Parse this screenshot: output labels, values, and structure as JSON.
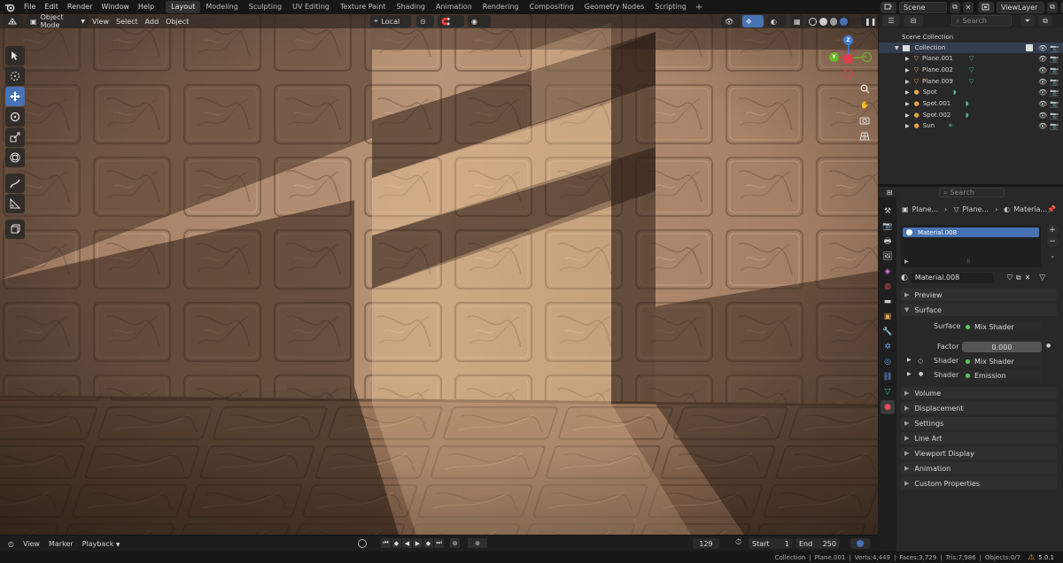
{
  "menubar": {
    "items": [
      "File",
      "Edit",
      "Render",
      "Window",
      "Help"
    ],
    "workspaces": [
      "Layout",
      "Modeling",
      "Sculpting",
      "UV Editing",
      "Texture Paint",
      "Shading",
      "Animation",
      "Rendering",
      "Compositing",
      "Geometry Nodes",
      "Scripting"
    ],
    "active_workspace": "Layout",
    "add_tab": "+",
    "scene_name": "Scene",
    "viewlayer_name": "ViewLayer"
  },
  "viewport": {
    "mode": "Object Mode",
    "menus": [
      "View",
      "Select",
      "Add",
      "Object"
    ],
    "orientation": "Local",
    "gizmo_axes": [
      "X",
      "Y",
      "Z"
    ]
  },
  "timeline": {
    "menus": [
      "View",
      "Marker",
      "Playback"
    ],
    "current_frame": "129",
    "start_label": "Start",
    "start_value": "1",
    "end_label": "End",
    "end_value": "250"
  },
  "status": {
    "collection": "Collection",
    "object": "Plane.001",
    "verts": "Verts:4,449",
    "faces": "Faces:3,729",
    "tris": "Tris:7,986",
    "objects": "Objects:0/7",
    "version": "5.0.1"
  },
  "outliner": {
    "search_placeholder": "Search",
    "root": "Scene Collection",
    "collection": "Collection",
    "items": [
      {
        "name": "Plane.001",
        "type": "mesh"
      },
      {
        "name": "Plane.002",
        "type": "mesh"
      },
      {
        "name": "Plane.009",
        "type": "mesh"
      },
      {
        "name": "Spot",
        "type": "light"
      },
      {
        "name": "Spot.001",
        "type": "light"
      },
      {
        "name": "Spot.002",
        "type": "light"
      },
      {
        "name": "Sun",
        "type": "sun"
      }
    ]
  },
  "properties": {
    "search_placeholder": "Search",
    "breadcrumb": [
      "Plane...",
      "Plane...",
      "Materia..."
    ],
    "slot": "Material.008",
    "material_name": "Material.008",
    "panels_top": [
      "Preview",
      "Surface"
    ],
    "surface_label": "Surface",
    "surface_value": "Mix Shader",
    "factor_label": "Factor",
    "factor_value": "0.000",
    "shader_label": "Shader",
    "shader1_value": "Mix Shader",
    "shader2_value": "Emission",
    "panels_bottom": [
      "Volume",
      "Displacement",
      "Settings",
      "Line Art",
      "Viewport Display",
      "Animation",
      "Custom Properties"
    ]
  },
  "colors": {
    "accent": "#4772b3",
    "header": "#161616",
    "panel": "#282828",
    "x_axis": "#e03c4b",
    "y_axis": "#6bb52a",
    "z_axis": "#3f7fd9"
  }
}
